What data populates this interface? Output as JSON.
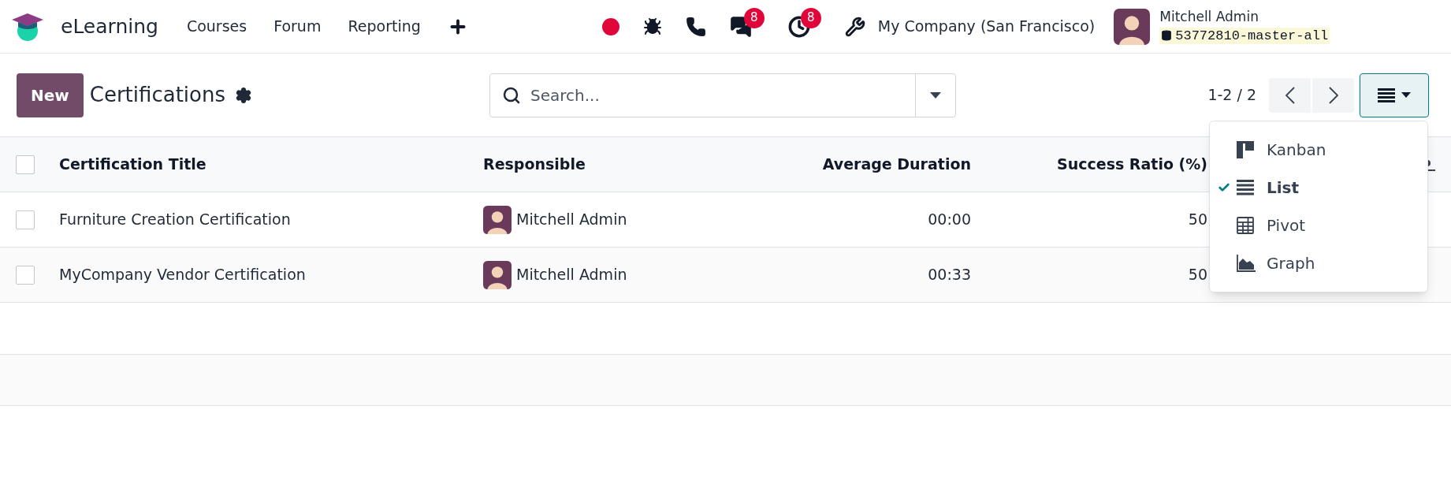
{
  "navbar": {
    "app_name": "eLearning",
    "menu": [
      {
        "label": "Courses"
      },
      {
        "label": "Forum"
      },
      {
        "label": "Reporting"
      }
    ],
    "systray": {
      "chat_count": "8",
      "activity_count": "8"
    },
    "company": "My Company (San Francisco)",
    "user": {
      "name": "Mitchell Admin",
      "database": "53772810-master-all"
    }
  },
  "control_panel": {
    "new_button": "New",
    "title": "Certifications",
    "search": {
      "placeholder": "Search..."
    },
    "pager": "1-2 / 2"
  },
  "table": {
    "header_checked": false,
    "columns": [
      {
        "label": "Certification Title"
      },
      {
        "label": "Responsible"
      },
      {
        "label": "Average Duration"
      },
      {
        "label": "Success Ratio (%)"
      }
    ],
    "rows": [
      {
        "checked": false,
        "title": "Furniture Creation Certification",
        "responsible": "Mitchell Admin",
        "average_duration": "00:00",
        "success_ratio": "50"
      },
      {
        "checked": false,
        "title": "MyCompany Vendor Certification",
        "responsible": "Mitchell Admin",
        "average_duration": "00:33",
        "success_ratio": "50"
      }
    ]
  },
  "view_menu": {
    "items": [
      {
        "kind": "kanban",
        "label": "Kanban",
        "selected": false
      },
      {
        "kind": "list",
        "label": "List",
        "selected": true
      },
      {
        "kind": "pivot",
        "label": "Pivot",
        "selected": false
      },
      {
        "kind": "graph",
        "label": "Graph",
        "selected": false
      }
    ]
  }
}
